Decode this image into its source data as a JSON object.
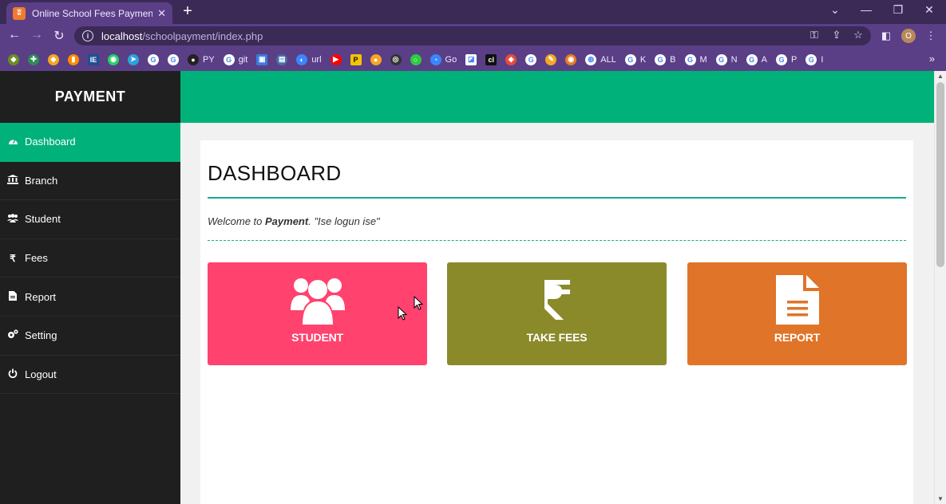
{
  "browser": {
    "tab_title": "Online School Fees Payment Syst",
    "tab_favicon": "xampp-icon",
    "new_tab": "+",
    "url_host": "localhost",
    "url_path": "/schoolpayment/index.php",
    "profile_initial": "O",
    "bookmarks": [
      {
        "icon": "ext",
        "color": "#6b8e23",
        "label": ""
      },
      {
        "icon": "plus-cross",
        "color": "#2e8b57",
        "label": ""
      },
      {
        "icon": "ext",
        "color": "#f5a623",
        "label": ""
      },
      {
        "icon": "chart",
        "color": "#ff8c00",
        "label": ""
      },
      {
        "icon": "ieee",
        "color": "#1d4f91",
        "label": ""
      },
      {
        "icon": "whatsapp",
        "color": "#25d366",
        "label": ""
      },
      {
        "icon": "telegram",
        "color": "#2aa3e0",
        "label": ""
      },
      {
        "icon": "google",
        "color": "#ffffff",
        "label": ""
      },
      {
        "icon": "google",
        "color": "#ffffff",
        "label": ""
      },
      {
        "icon": "github",
        "color": "#222222",
        "label": "PY"
      },
      {
        "icon": "google",
        "color": "#ffffff",
        "label": "git"
      },
      {
        "icon": "image",
        "color": "#3b7ddd",
        "label": ""
      },
      {
        "icon": "store",
        "color": "#4a6fa5",
        "label": ""
      },
      {
        "icon": "edge",
        "color": "#3a86ff",
        "label": "url"
      },
      {
        "icon": "youtube",
        "color": "#ff0000",
        "label": ""
      },
      {
        "icon": "p",
        "color": "#f2c500",
        "label": ""
      },
      {
        "icon": "camera",
        "color": "#f5a623",
        "label": ""
      },
      {
        "icon": "brain",
        "color": "#333333",
        "label": ""
      },
      {
        "icon": "ring",
        "color": "#2ecc40",
        "label": ""
      },
      {
        "icon": "globe",
        "color": "#3a86ff",
        "label": "Go"
      },
      {
        "icon": "book",
        "color": "#ffffff",
        "label": ""
      },
      {
        "icon": "cl",
        "color": "#111111",
        "label": ""
      },
      {
        "icon": "ext",
        "color": "#e74c3c",
        "label": ""
      },
      {
        "icon": "google",
        "color": "#ffffff",
        "label": ""
      },
      {
        "icon": "pen",
        "color": "#f5a623",
        "label": ""
      },
      {
        "icon": "eye",
        "color": "#e67e22",
        "label": ""
      },
      {
        "icon": "world",
        "color": "#ffffff",
        "label": "ALL"
      },
      {
        "icon": "google",
        "color": "#ffffff",
        "label": "K"
      },
      {
        "icon": "google",
        "color": "#ffffff",
        "label": "B"
      },
      {
        "icon": "google",
        "color": "#ffffff",
        "label": "M"
      },
      {
        "icon": "google",
        "color": "#ffffff",
        "label": "N"
      },
      {
        "icon": "google",
        "color": "#ffffff",
        "label": "A"
      },
      {
        "icon": "google",
        "color": "#ffffff",
        "label": "P"
      },
      {
        "icon": "google",
        "color": "#ffffff",
        "label": "I"
      }
    ]
  },
  "sidebar": {
    "brand": "PAYMENT",
    "items": [
      {
        "label": "Dashboard",
        "icon": "dashboard-icon",
        "active": true
      },
      {
        "label": "Branch",
        "icon": "bank-icon",
        "active": false
      },
      {
        "label": "Student",
        "icon": "users-icon",
        "active": false
      },
      {
        "label": "Fees",
        "icon": "rupee-icon",
        "active": false
      },
      {
        "label": "Report",
        "icon": "file-icon",
        "active": false
      },
      {
        "label": "Setting",
        "icon": "cogs-icon",
        "active": false
      },
      {
        "label": "Logout",
        "icon": "power-icon",
        "active": false
      }
    ]
  },
  "main": {
    "title": "DASHBOARD",
    "welcome_prefix": "Welcome to ",
    "welcome_brand": "Payment",
    "welcome_suffix": ". \"Ise logun ise\"",
    "cards": [
      {
        "label": "STUDENT",
        "icon": "users-icon",
        "color": "#ff426e"
      },
      {
        "label": "TAKE FEES",
        "icon": "rupee-icon",
        "color": "#8a8a2b"
      },
      {
        "label": "REPORT",
        "icon": "file-icon",
        "color": "#e07428"
      }
    ]
  },
  "colors": {
    "accent": "#00b27a",
    "sidebar_bg": "#1f1f1f",
    "browser_frame": "#5a3f86"
  }
}
